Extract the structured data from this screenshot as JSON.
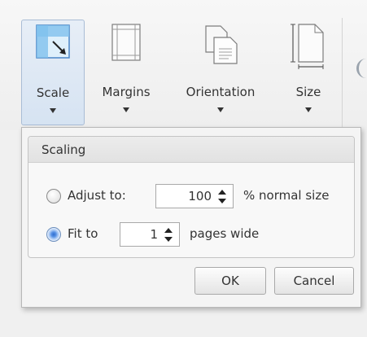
{
  "ribbon": {
    "buttons": [
      {
        "label": "Scale",
        "icon": "scale-icon",
        "selected": true
      },
      {
        "label": "Margins",
        "icon": "margins-icon"
      },
      {
        "label": "Orientation",
        "icon": "orientation-icon"
      },
      {
        "label": "Size",
        "icon": "size-icon"
      }
    ]
  },
  "scaling_panel": {
    "group_title": "Scaling",
    "adjust_to": {
      "label": "Adjust to:",
      "value": "100",
      "suffix": "% normal size",
      "checked": false
    },
    "fit_to": {
      "label": "Fit to",
      "value": "1",
      "suffix": "pages wide",
      "checked": true
    },
    "ok_label": "OK",
    "cancel_label": "Cancel"
  },
  "colors": {
    "selected_button_bg": "#d6e3f2",
    "selected_border": "#a9bdd6",
    "radio_checked": "#2f6fcf"
  }
}
